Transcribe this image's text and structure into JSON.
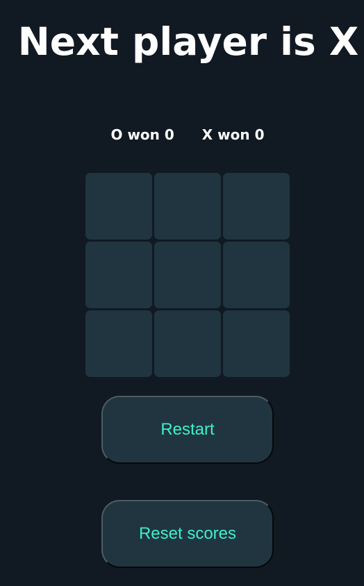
{
  "status": {
    "title": "Next player is X"
  },
  "scores": {
    "o_label": "O won 0",
    "x_label": "X won 0"
  },
  "board": {
    "cells": [
      "",
      "",
      "",
      "",
      "",
      "",
      "",
      "",
      ""
    ]
  },
  "controls": {
    "restart_label": "Restart",
    "reset_scores_label": "Reset scores"
  },
  "colors": {
    "background": "#111922",
    "cell": "#203540",
    "accent_text": "#3ef0c8",
    "text": "#ffffff"
  }
}
